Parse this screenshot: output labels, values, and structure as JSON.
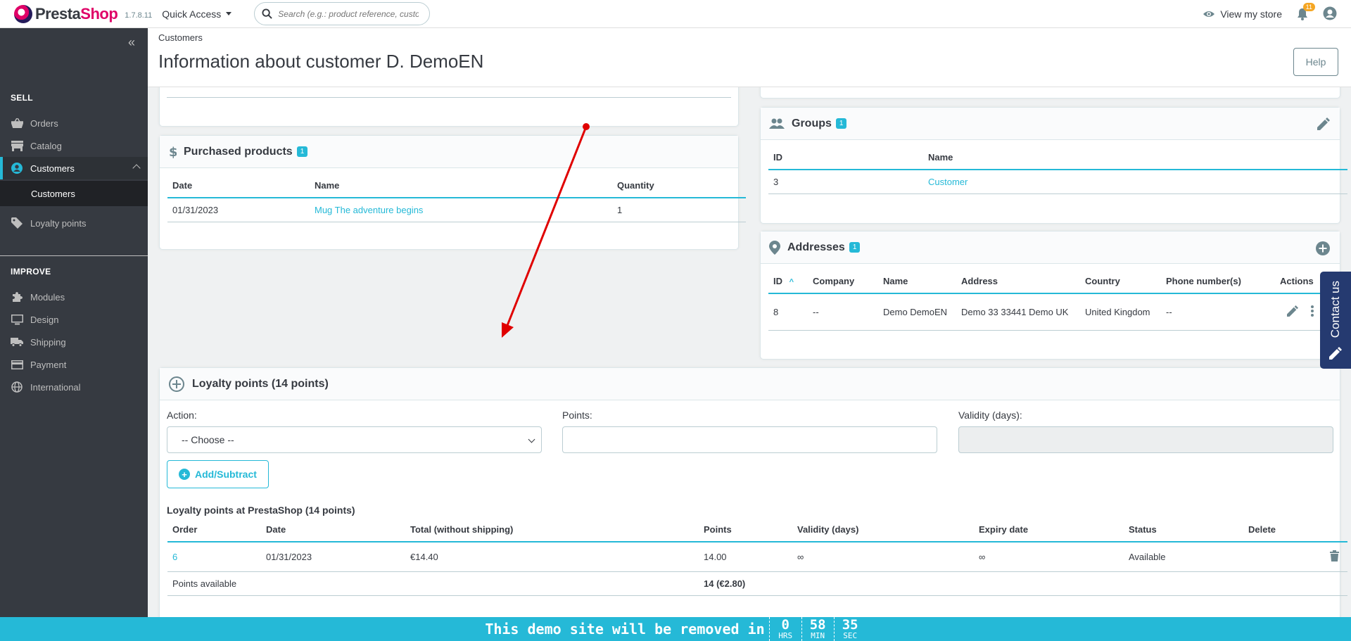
{
  "topbar": {
    "logo_pre": "Presta",
    "logo_post": "Shop",
    "version": "1.7.8.11",
    "quick_access": "Quick Access",
    "search_placeholder": "Search (e.g.: product reference, custon",
    "view_store": "View my store",
    "notif_count": "11"
  },
  "sidebar": {
    "sell": "SELL",
    "improve": "IMPROVE",
    "items": {
      "orders": "Orders",
      "catalog": "Catalog",
      "customers": "Customers",
      "customers_sub": "Customers",
      "loyalty": "Loyalty points",
      "modules": "Modules",
      "design": "Design",
      "shipping": "Shipping",
      "payment": "Payment",
      "international": "International"
    }
  },
  "header": {
    "breadcrumb": "Customers",
    "title": "Information about customer D. DemoEN",
    "help": "Help"
  },
  "purchased": {
    "title": "Purchased products",
    "count": "1",
    "columns": [
      "Date",
      "Name",
      "Quantity"
    ],
    "rows": [
      {
        "date": "01/31/2023",
        "name": "Mug The adventure begins",
        "qty": "1"
      }
    ]
  },
  "groups": {
    "title": "Groups",
    "count": "1",
    "columns": [
      "ID",
      "Name"
    ],
    "rows": [
      {
        "id": "3",
        "name": "Customer"
      }
    ]
  },
  "addresses": {
    "title": "Addresses",
    "count": "1",
    "columns": [
      "ID",
      "Company",
      "Name",
      "Address",
      "Country",
      "Phone number(s)",
      "Actions"
    ],
    "rows": [
      {
        "id": "8",
        "company": "--",
        "name": "Demo DemoEN",
        "address": "Demo 33 33441 Demo UK",
        "country": "United Kingdom",
        "phone": "--"
      }
    ]
  },
  "loyalty": {
    "title": "Loyalty points (14 points)",
    "action_label": "Action:",
    "action_value": "-- Choose --",
    "points_label": "Points:",
    "validity_label": "Validity (days):",
    "add_button": "Add/Subtract",
    "table_title": "Loyalty points at PrestaShop (14 points)",
    "columns": [
      "Order",
      "Date",
      "Total (without shipping)",
      "Points",
      "Validity (days)",
      "Expiry date",
      "Status",
      "Delete"
    ],
    "rows": [
      {
        "order": "6",
        "date": "01/31/2023",
        "total": "€14.40",
        "points": "14.00",
        "validity": "∞",
        "expiry": "∞",
        "status": "Available"
      }
    ],
    "footer_label": "Points available",
    "footer_value": "14 (€2.80)"
  },
  "contact_tab": "Contact us",
  "demo_bar": {
    "text": "This demo site will be removed in",
    "hrs": "0",
    "hrs_unit": "HRS",
    "min": "58",
    "min_unit": "MIN",
    "sec": "35",
    "sec_unit": "SEC"
  },
  "colors": {
    "accent": "#25b9d7",
    "sidebar": "#363a41",
    "brand": "#df0067",
    "annotation": "#e00000"
  }
}
